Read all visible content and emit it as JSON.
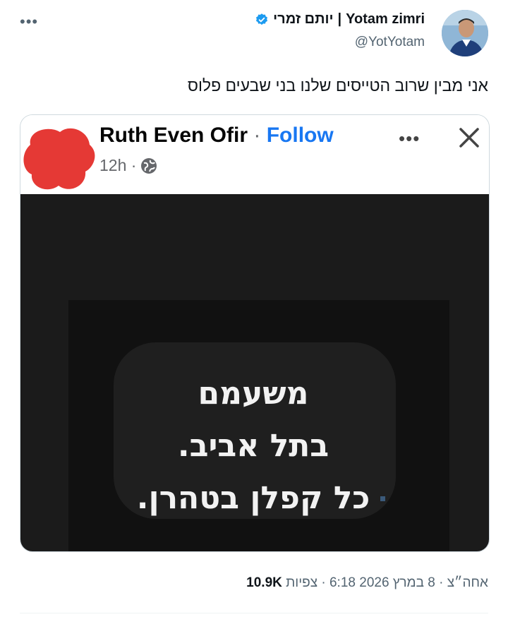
{
  "tweet": {
    "more_label": "•••",
    "author_name_latin": "Yotam zimri",
    "author_separator": "|",
    "author_name_hebrew": "יותם זמרי",
    "handle": "@YotYotam",
    "text": "אני מבין שרוב הטייסים שלנו בני שבעים פלוס",
    "meta": {
      "datetime": "אחה״צ · 8 במרץ 2026 6:18 ·",
      "views_label": "צפיות",
      "views_count": "10.9K"
    }
  },
  "embedded_post": {
    "name": "Ruth Even Ofir",
    "dot": "·",
    "follow_label": "Follow",
    "time": "12h ·",
    "more_label": "•••",
    "quote_lines": [
      "משעמם",
      "בתל אביב.",
      "כל קפלן בטהרן."
    ]
  },
  "colors": {
    "accent": "#1d9bf0",
    "fb_blue": "#1877f2",
    "redaction": "#e53935",
    "photo_bg": "#1b1b1b"
  }
}
